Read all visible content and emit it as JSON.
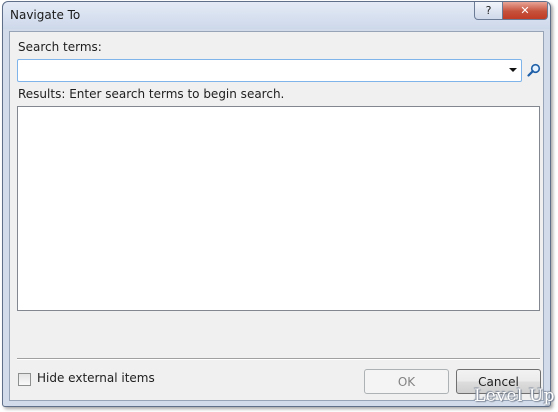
{
  "window": {
    "title": "Navigate To",
    "help_glyph": "?",
    "close_glyph": "✕"
  },
  "search": {
    "label": "Search terms:",
    "value": "",
    "placeholder": "",
    "icon": "magnifier-icon"
  },
  "results": {
    "status": "Results: Enter search terms to begin search.",
    "items": []
  },
  "options": {
    "hide_external_label": "Hide external items",
    "hide_external_checked": false
  },
  "buttons": {
    "ok_label": "OK",
    "ok_enabled": false,
    "cancel_label": "Cancel"
  },
  "watermark": "Level Up",
  "colors": {
    "accent_border": "#7eb4ea",
    "close_button": "#c6513b",
    "frame": "#d2dbe9"
  }
}
